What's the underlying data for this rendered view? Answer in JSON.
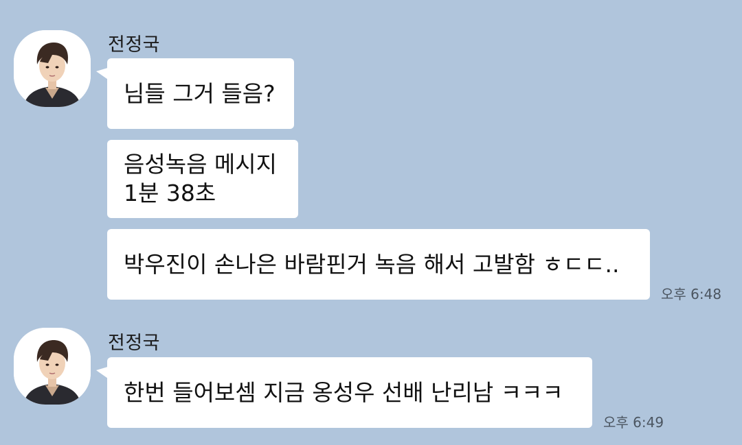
{
  "groups": [
    {
      "sender": "전정국",
      "messages": [
        {
          "text": "님들 그거 들음?"
        },
        {
          "text": "음성녹음 메시지\n1분 38초"
        },
        {
          "text": "박우진이 손나은 바람핀거 녹음 해서 고발함 ㅎㄷㄷ.."
        }
      ],
      "time": "오후 6:48"
    },
    {
      "sender": "전정국",
      "messages": [
        {
          "text": "한번 들어보셈 지금 옹성우 선배 난리남 ㅋㅋㅋ"
        }
      ],
      "time": "오후 6:49"
    }
  ],
  "colors": {
    "background": "#b0c5dc",
    "bubble": "#ffffff",
    "text": "#111111"
  }
}
